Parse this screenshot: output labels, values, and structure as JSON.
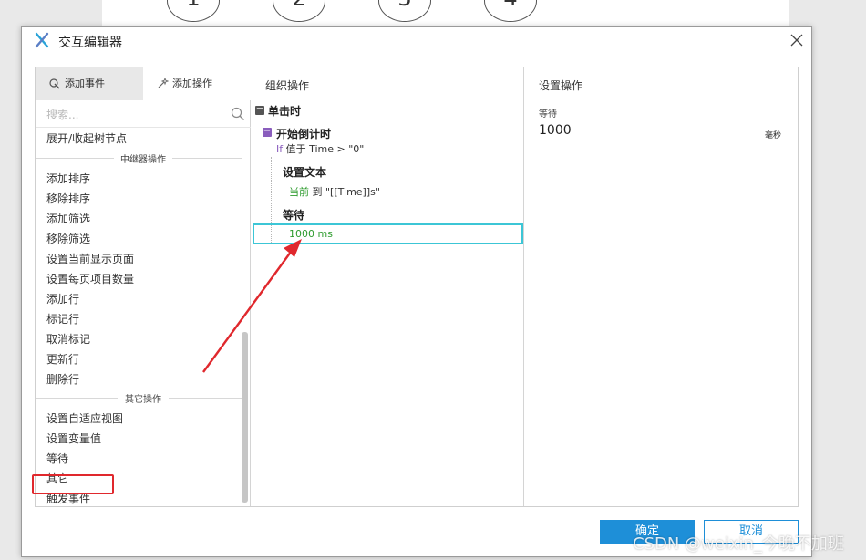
{
  "background_steps": [
    "1",
    "2",
    "3",
    "4"
  ],
  "dialog": {
    "title": "交互编辑器",
    "icon": "x-logo-icon",
    "close_icon": "close-icon"
  },
  "left_panel": {
    "tabs": [
      {
        "label": "添加事件",
        "icon": "event-icon",
        "active": true
      },
      {
        "label": "添加操作",
        "icon": "sparkle-icon",
        "active": false
      }
    ],
    "search_placeholder": "搜索...",
    "items_top": [
      "展开/收起树节点"
    ],
    "group_repeater": "中继器操作",
    "items_repeater": [
      "添加排序",
      "移除排序",
      "添加筛选",
      "移除筛选",
      "设置当前显示页面",
      "设置每页项目数量",
      "添加行",
      "标记行",
      "取消标记",
      "更新行",
      "删除行"
    ],
    "group_other": "其它操作",
    "items_other": [
      "设置自适应视图",
      "设置变量值",
      "等待",
      "其它",
      "触发事件"
    ]
  },
  "middle_panel": {
    "title": "组织操作",
    "event": "单击时",
    "case": "开始倒计时",
    "condition_if": "If",
    "condition_text": "值于 Time > \"0\"",
    "action1_title": "设置文本",
    "action1_target": "当前",
    "action1_rest": " 到 \"[[Time]]s\"",
    "action2_title": "等待",
    "action2_detail": "1000 ms"
  },
  "right_panel": {
    "title": "设置操作",
    "field_label": "等待",
    "field_value": "1000",
    "unit": "毫秒"
  },
  "buttons": {
    "ok": "确定",
    "cancel": "取消"
  },
  "watermark": "CSDN @weixin_今晚不加班",
  "colors": {
    "accent": "#1e8fd8",
    "highlight_cyan": "#3cc6d6",
    "annotation_red": "#e0282d",
    "green_text": "#2e9b2e",
    "toggle_purple": "#8a5dbd"
  }
}
